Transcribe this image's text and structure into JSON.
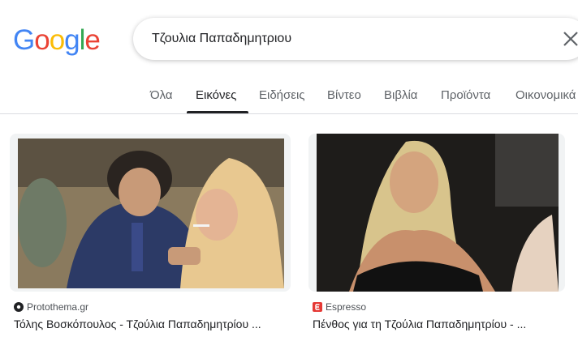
{
  "logo": {
    "letters": [
      "G",
      "o",
      "o",
      "g",
      "l",
      "e"
    ],
    "colors": [
      "#4285F4",
      "#EA4335",
      "#FBBC05",
      "#4285F4",
      "#34A853",
      "#EA4335"
    ]
  },
  "search": {
    "query": "Τζουλια Παπαδημητριου",
    "clear_icon": "close-icon"
  },
  "tabs": [
    {
      "label": "Όλα",
      "active": false
    },
    {
      "label": "Εικόνες",
      "active": true
    },
    {
      "label": "Ειδήσεις",
      "active": false
    },
    {
      "label": "Βίντεο",
      "active": false
    },
    {
      "label": "Βιβλία",
      "active": false
    },
    {
      "label": "Προϊόντα",
      "active": false
    },
    {
      "label": "Οικονομικά",
      "active": false
    }
  ],
  "results": [
    {
      "source": "Protothema.gr",
      "favicon": "protothema-favicon",
      "title": "Τόλης Βοσκόπουλος - Τζούλια Παπαδημητρίου ..."
    },
    {
      "source": "Espresso",
      "favicon": "espresso-favicon",
      "title": "Πένθος για τη Τζούλια Παπαδημητρίου - ..."
    }
  ],
  "colors": {
    "tab_inactive": "#5f6368",
    "tab_active": "#202124",
    "divider": "#dadce0",
    "espresso_red": "#e53935"
  }
}
